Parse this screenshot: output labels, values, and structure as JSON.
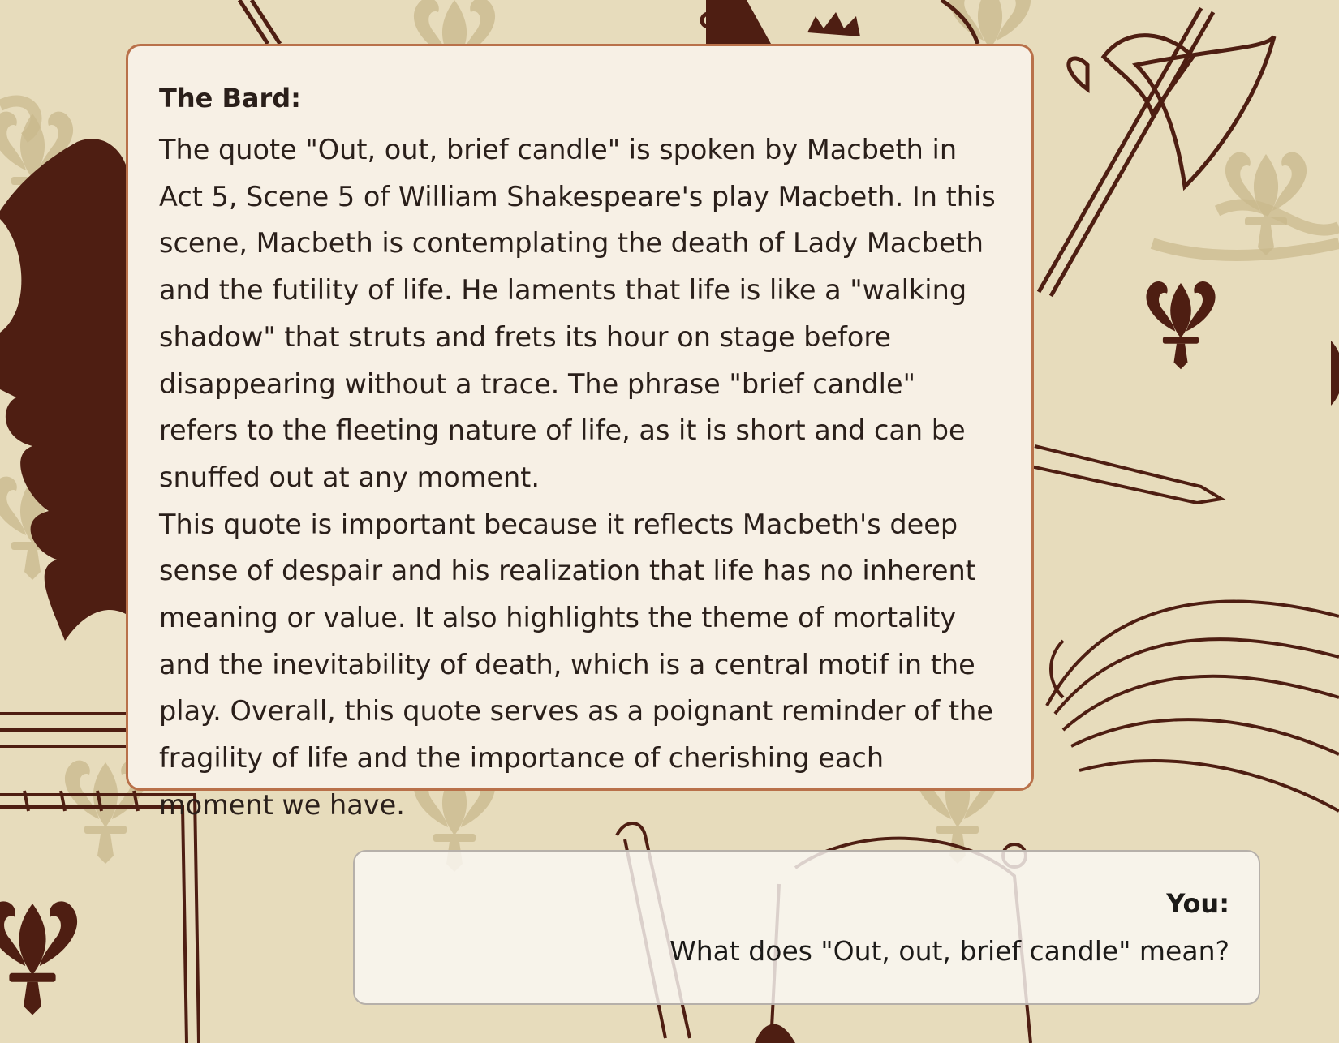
{
  "chat": {
    "bard": {
      "speaker": "The Bard:",
      "paragraphs": [
        "The quote \"Out, out, brief candle\" is spoken by Macbeth in Act 5, Scene 5 of William Shakespeare's play Macbeth. In this scene, Macbeth is contemplating the death of Lady Macbeth and the futility of life. He laments that life is like a \"walking shadow\" that struts and frets its hour on stage before disappearing without a trace. The phrase \"brief candle\" refers to the fleeting nature of life, as it is short and can be snuffed out at any moment.",
        "This quote is important because it reflects Macbeth's deep sense of despair and his realization that life has no inherent meaning or value. It also highlights the theme of mortality and the inevitability of death, which is a central motif in the play. Overall, this quote serves as a poignant reminder of the fragility of life and the importance of cherishing each moment we have."
      ]
    },
    "user": {
      "speaker": "You:",
      "message": "What does \"Out, out, brief candle\" mean?"
    }
  },
  "background": {
    "description_icons": [
      "lion-rampant-icon",
      "halberd-axe-icon",
      "fleur-de-lis-icon",
      "feathered-helmet-icon",
      "sword-icon",
      "crown-icon",
      "shield-icon"
    ],
    "colors": {
      "base": "#e7dcbc",
      "pattern": "#c9b88c",
      "ink": "#4e1e12"
    }
  }
}
